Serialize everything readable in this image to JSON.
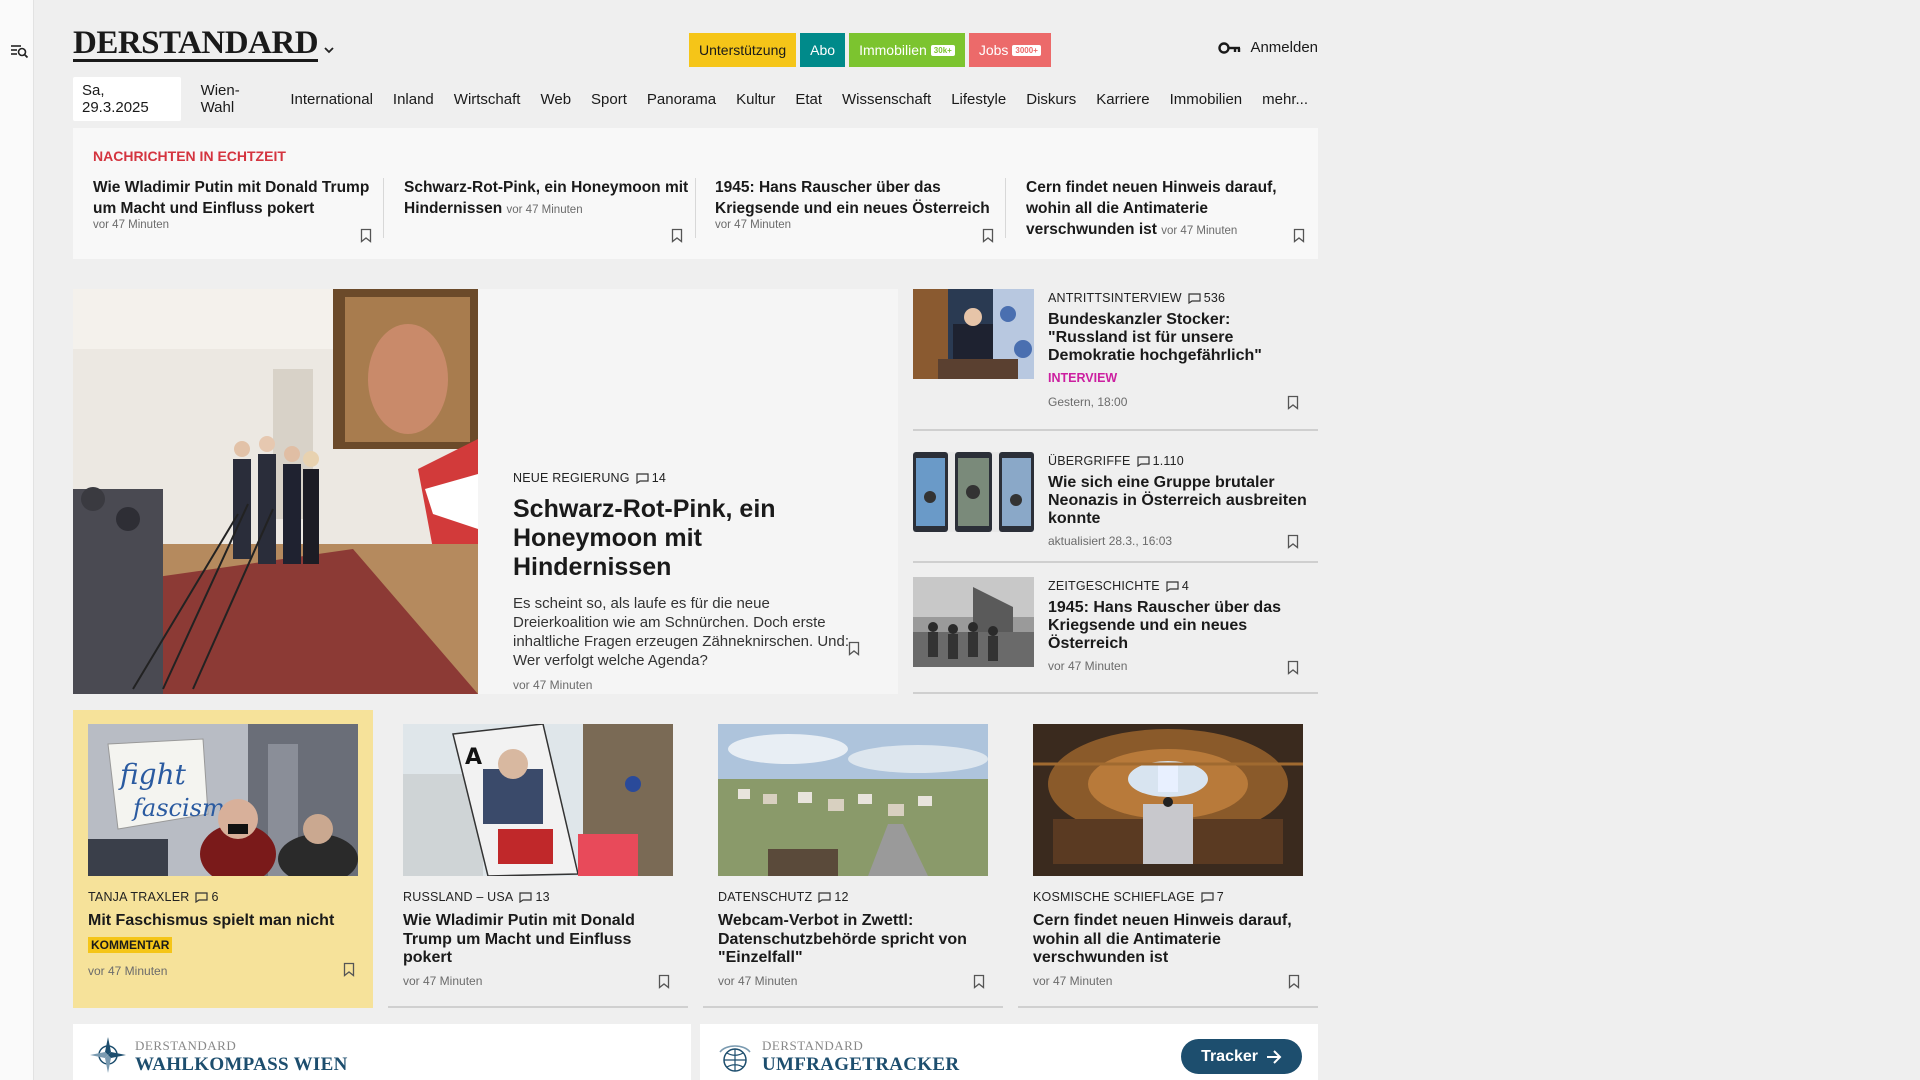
{
  "header": {
    "logo": "DERSTANDARD",
    "pills": [
      {
        "label": "Unterstützung",
        "bg": "#f5c518",
        "fg": "#1a1a1a",
        "tag": ""
      },
      {
        "label": "Abo",
        "bg": "#008a8a",
        "fg": "#ffffff",
        "tag": ""
      },
      {
        "label": "Immobilien",
        "bg": "#7cc42f",
        "fg": "#ffffff",
        "tag": "30k+"
      },
      {
        "label": "Jobs",
        "bg": "#ec6a6a",
        "fg": "#ffffff",
        "tag": "3000+"
      }
    ],
    "login_label": "Anmelden"
  },
  "nav": {
    "date": "Sa, 29.3.2025",
    "items": [
      "Wien-Wahl",
      "International",
      "Inland",
      "Wirtschaft",
      "Web",
      "Sport",
      "Panorama",
      "Kultur",
      "Etat",
      "Wissenschaft",
      "Lifestyle",
      "Diskurs",
      "Karriere",
      "Immobilien",
      "mehr..."
    ]
  },
  "live": {
    "label": "NACHRICHTEN IN ECHTZEIT",
    "items": [
      {
        "title": "Wie Wladimir Putin mit Donald Trump um Macht und Einfluss pokert",
        "time": "vor 47 Minuten",
        "inline": false
      },
      {
        "title": "Schwarz-Rot-Pink, ein Honeymoon mit Hindernissen",
        "time": "vor 47 Minuten",
        "inline": true
      },
      {
        "title": "1945: Hans Rauscher über das Kriegsende und ein neues Österreich",
        "time": "vor 47 Minuten",
        "inline": false
      },
      {
        "title": "Cern findet neuen Hinweis darauf, wohin all die Antimaterie verschwunden ist",
        "time": "vor 47 Minuten",
        "inline": true
      }
    ]
  },
  "hero": {
    "kicker": "NEUE REGIERUNG",
    "comments": "14",
    "title": "Schwarz-Rot-Pink, ein Honeymoon mit Hindernissen",
    "description": "Es scheint so, als laufe es für die neue Dreierkoalition wie am Schnürchen. Doch erste inhaltliche Fragen erzeugen Zähneknirschen. Und: Wer verfolgt welche Agenda?",
    "time": "vor 47 Minuten"
  },
  "side": [
    {
      "kicker": "ANTRITTSINTERVIEW",
      "comments": "536",
      "title": "Bundeskanzler Stocker: \"Russland ist für unsere Demokratie hochgefährlich\"",
      "badge": "INTERVIEW",
      "time": "Gestern, 18:00"
    },
    {
      "kicker": "ÜBERGRIFFE",
      "comments": "1.110",
      "title": "Wie sich eine Gruppe brutaler Neonazis in Österreich ausbreiten konnte",
      "badge": "",
      "time": "aktualisiert 28.3., 16:03"
    },
    {
      "kicker": "ZEITGESCHICHTE",
      "comments": "4",
      "title": "1945: Hans Rauscher über das Kriegsende und ein neues Österreich",
      "badge": "",
      "time": "vor 47 Minuten"
    }
  ],
  "cards": [
    {
      "kicker": "TANJA TRAXLER",
      "comments": "6",
      "title": "Mit Faschismus spielt man nicht",
      "badge": "KOMMENTAR",
      "time": "vor 47 Minuten",
      "highlight": true
    },
    {
      "kicker": "RUSSLAND – USA",
      "comments": "13",
      "title": "Wie Wladimir Putin mit Donald Trump um Macht und Einfluss pokert",
      "badge": "",
      "time": "vor 47 Minuten",
      "highlight": false
    },
    {
      "kicker": "DATENSCHUTZ",
      "comments": "12",
      "title": "Webcam-Verbot in Zwettl: Datenschutzbehörde spricht von \"Einzelfall\"",
      "badge": "",
      "time": "vor 47 Minuten",
      "highlight": false
    },
    {
      "kicker": "KOSMISCHE SCHIEFLAGE",
      "comments": "7",
      "title": "Cern findet neuen Hinweis darauf, wohin all die Antimaterie verschwunden ist",
      "badge": "",
      "time": "vor 47 Minuten",
      "highlight": false
    }
  ],
  "promos": [
    {
      "brand": "DERSTANDARD",
      "name": "WAHLKOMPASS WIEN"
    },
    {
      "brand": "DERSTANDARD",
      "name": "UMFRAGETRACKER",
      "button": "Tracker"
    }
  ],
  "colors": {
    "accent_red": "#d4343f",
    "interview_pink": "#cc1fa0",
    "kommentar_yellow": "#f5c518",
    "card_highlight": "#f6e29a",
    "promo_blue": "#1d4e6e"
  },
  "icons": [
    "menu-search-icon",
    "chevron-down-icon",
    "key-icon",
    "comment-icon",
    "bookmark-icon",
    "arrow-right-icon",
    "compass-icon",
    "globe-icon"
  ]
}
